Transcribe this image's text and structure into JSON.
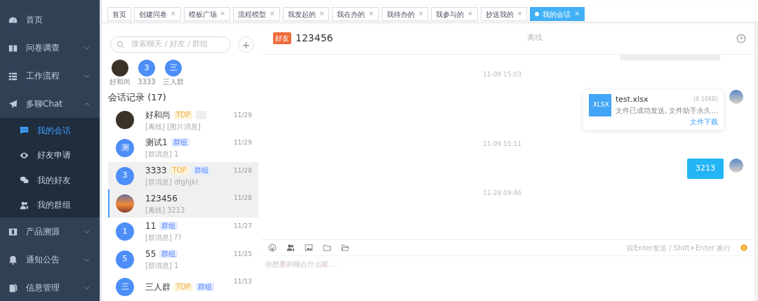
{
  "sidebar": {
    "items": [
      {
        "label": "首页"
      },
      {
        "label": "问卷调查",
        "expanded": false
      },
      {
        "label": "工作流程",
        "expanded": false
      },
      {
        "label": "多聊Chat",
        "expanded": true,
        "children": [
          {
            "label": "我的会话",
            "selected": true
          },
          {
            "label": "好友申请",
            "selected": false
          },
          {
            "label": "我的好友",
            "selected": false
          },
          {
            "label": "我的群组",
            "selected": false
          }
        ]
      },
      {
        "label": "产品溯源",
        "expanded": false
      },
      {
        "label": "通知公告",
        "expanded": false
      },
      {
        "label": "信息管理",
        "expanded": false
      }
    ]
  },
  "tabs": [
    {
      "label": "首页",
      "selected": false
    },
    {
      "label": "创建问卷",
      "close": "×",
      "selected": false
    },
    {
      "label": "模板广场",
      "close": "×",
      "selected": false
    },
    {
      "label": "流程模型",
      "close": "×",
      "selected": false
    },
    {
      "label": "我发起的",
      "close": "×",
      "selected": false
    },
    {
      "label": "我在办的",
      "close": "×",
      "selected": false
    },
    {
      "label": "我待办的",
      "close": "×",
      "selected": false
    },
    {
      "label": "我参与的",
      "close": "×",
      "selected": false
    },
    {
      "label": "抄送我的",
      "close": "×",
      "selected": false
    },
    {
      "label": "我的会话",
      "close": "×",
      "selected": true
    }
  ],
  "search": {
    "placeholder": "搜索聊天 / 好友 / 群组"
  },
  "add_button": "+",
  "pinned": [
    {
      "name": "好和尚",
      "kind": "photo"
    },
    {
      "name": "3333",
      "kind": "letter",
      "letter": "3"
    },
    {
      "name": "三人群",
      "kind": "letter",
      "letter": "三"
    }
  ],
  "history_title": "会话记录 (17)",
  "conversations": [
    {
      "name": "好和尚",
      "kind": "photo",
      "tags": [
        {
          "kind": "top",
          "text": "TOP"
        },
        {
          "kind": "blank"
        }
      ],
      "preview": "[离线]  [图片消息]",
      "date": "11/29",
      "selected": false,
      "hovered": false
    },
    {
      "name": "测试1",
      "kind": "letter",
      "letter": "测",
      "tags": [
        {
          "kind": "group",
          "text": "群组"
        }
      ],
      "preview": "[群消息] 1",
      "date": "11/29",
      "selected": false,
      "hovered": false
    },
    {
      "name": "3333",
      "kind": "letter",
      "letter": "3",
      "tags": [
        {
          "kind": "top",
          "text": "TOP"
        },
        {
          "kind": "group",
          "text": "群组"
        }
      ],
      "preview": "[群消息] dfghjkl",
      "date": "11/28",
      "selected": false,
      "hovered": true
    },
    {
      "name": "123456",
      "kind": "photo",
      "preview": "[离线]  3213",
      "date": "11/28",
      "selected": true,
      "hovered": false
    },
    {
      "name": "11",
      "kind": "letter",
      "letter": "1",
      "tags": [
        {
          "kind": "group",
          "text": "群组"
        }
      ],
      "preview": "[群消息] ??",
      "date": "11/27",
      "selected": false,
      "hovered": false
    },
    {
      "name": "55",
      "kind": "letter",
      "letter": "5",
      "tags": [
        {
          "kind": "group",
          "text": "群组"
        }
      ],
      "preview": "[群消息] 1",
      "date": "11/25",
      "selected": false,
      "hovered": false
    },
    {
      "name": "三人群",
      "kind": "letter",
      "letter": "三",
      "tags": [
        {
          "kind": "top",
          "text": "TOP"
        },
        {
          "kind": "group",
          "text": "群组"
        }
      ],
      "date": "11/13",
      "selected": false,
      "hovered": false
    }
  ],
  "chat": {
    "badge": "好友",
    "title": "123456",
    "status": "离线",
    "messages": [
      {
        "kind": "time",
        "text": "11-09 15:03"
      },
      {
        "kind": "file",
        "ext": ".XLSX",
        "filename": "test.xlsx",
        "size": "(6.16KB)",
        "note": "文件已成功发送, 文件助手永久...",
        "link": "文件下载"
      },
      {
        "kind": "time",
        "text": "11-09 15:11"
      },
      {
        "kind": "text",
        "text": "3213"
      },
      {
        "kind": "time",
        "text": "11-28 09:46"
      }
    ],
    "hint": "按Enter发送 / Shift+Enter 换行",
    "input_placeholder": "你想要的聊点什么呢 ..."
  }
}
